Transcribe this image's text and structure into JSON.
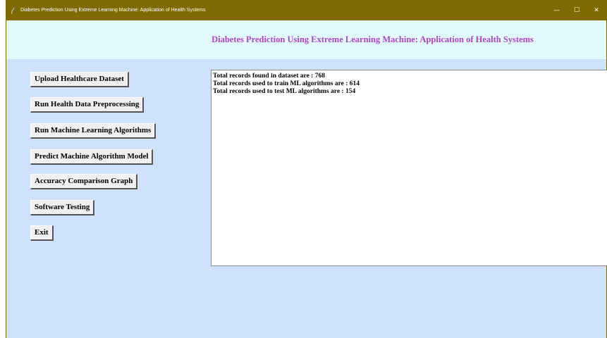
{
  "window": {
    "title": "Diabetes Prediction Using Extreme Learning Machine: Application of Health Systems",
    "icon": "feather-icon",
    "controls": {
      "minimize": "—",
      "maximize": "☐",
      "close": "✕"
    }
  },
  "header": {
    "title": "Diabetes Prediction Using Extreme Learning Machine: Application of Health Systems"
  },
  "buttons": {
    "upload": "Upload Healthcare Dataset",
    "preprocess": "Run Health Data Preprocessing",
    "run_ml": "Run Machine Learning Algorithms",
    "predict": "Predict Machine Algorithm Model",
    "accuracy": "Accuracy Comparison Graph",
    "testing": "Software Testing",
    "exit": "Exit"
  },
  "output": {
    "lines": [
      "Total records found in dataset are : 768",
      "Total records used to train ML algorithms are : 614",
      "Total records used to test ML algorithms are : 154"
    ]
  },
  "colors": {
    "titlebar": "#7e6a00",
    "window_bg": "#cfe2fb",
    "header_bg": "#e1fafe",
    "header_text": "#b143c7"
  }
}
